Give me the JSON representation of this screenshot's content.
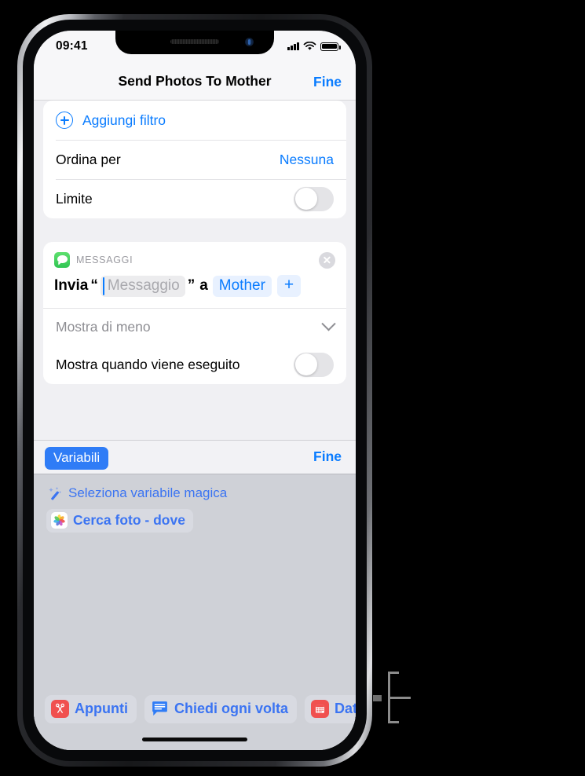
{
  "status_bar": {
    "time": "09:41",
    "signal_icon": "cellular-bars-icon",
    "wifi_icon": "wifi-icon",
    "battery_icon": "battery-full-icon"
  },
  "nav": {
    "title": "Send Photos To Mother",
    "done_label": "Fine"
  },
  "filter_card": {
    "add_filter_label": "Aggiungi filtro",
    "add_filter_icon": "plus-circle-icon",
    "sort_label": "Ordina per",
    "sort_value": "Nessuna",
    "limit_label": "Limite",
    "limit_toggle_state": "off"
  },
  "message_card": {
    "app_name": "MESSAGGI",
    "app_icon": "messages-app-icon",
    "close_icon": "close-circle-icon",
    "send_word": "Invia",
    "open_quote": "“",
    "message_placeholder": "Messaggio",
    "close_quote": "”",
    "to_word": "a",
    "recipient_token": "Mother",
    "add_recipient_label": "+",
    "show_less_label": "Mostra di meno",
    "show_less_icon": "chevron-down-icon",
    "show_when_run_label": "Mostra quando viene eseguito",
    "show_when_run_toggle_state": "off"
  },
  "accessory_bar": {
    "variables_label": "Variabili",
    "done_label": "Fine"
  },
  "variables_panel": {
    "magic_icon": "magic-wand-icon",
    "magic_label": "Seleziona variabile magica",
    "variable_chip_icon": "photos-app-icon",
    "variable_chip_label": "Cerca foto - dove"
  },
  "suggestions": [
    {
      "label": "Appunti",
      "icon": "clipboard-scissors-icon",
      "icon_color": "#f0504f"
    },
    {
      "label": "Chiedi ogni volta",
      "icon": "speech-bubble-icon",
      "icon_color": "#2f7cf6"
    },
    {
      "label": "Data a",
      "icon": "calendar-icon",
      "icon_color": "#f0504f"
    }
  ],
  "colors": {
    "accent_blue": "#0a7cff",
    "link_blue": "#3b74f2",
    "panel_gray": "#cfd1d7",
    "card_white": "#ffffff"
  },
  "annotation": {
    "bracket_icon": "callout-bracket-icon"
  }
}
